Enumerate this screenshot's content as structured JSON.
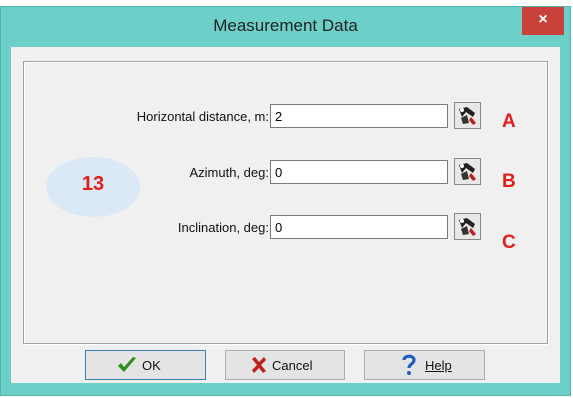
{
  "window": {
    "title": "Measurement Data",
    "close_glyph": "×"
  },
  "annotation": {
    "number": "13"
  },
  "fields": [
    {
      "label": "Horizontal distance, m:",
      "value": "2",
      "marker": "A"
    },
    {
      "label": "Azimuth, deg:",
      "value": "0",
      "marker": "B"
    },
    {
      "label": "Inclination, deg:",
      "value": "0",
      "marker": "C"
    }
  ],
  "buttons": {
    "ok_label": "OK",
    "cancel_label": "Cancel",
    "help_label": "Help"
  },
  "icons": {
    "ok": "checkmark-icon",
    "cancel": "x-icon",
    "help": "question-mark-icon",
    "pick": "measure-tool-icon"
  },
  "colors": {
    "title_bar": "#6cd0c9",
    "close": "#c8413b",
    "markers": "#e0201c"
  }
}
